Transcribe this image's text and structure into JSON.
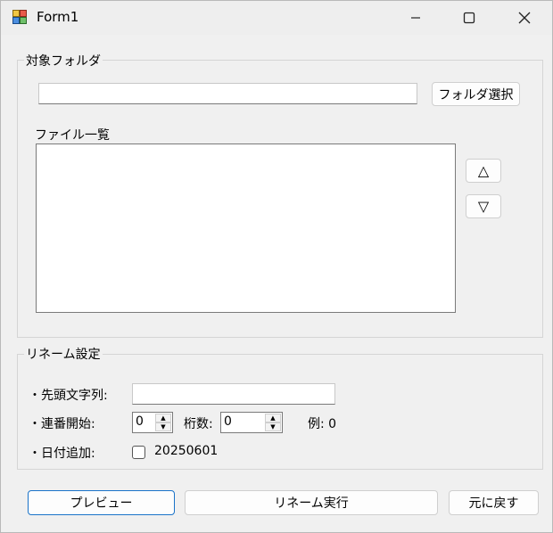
{
  "window": {
    "title": "Form1",
    "minimize_glyph": "—",
    "maximize_glyph": "☐",
    "close_glyph": "✕"
  },
  "folder_group": {
    "label": "対象フォルダ",
    "folder_path_value": "",
    "select_button": "フォルダ選択",
    "file_list_label": "ファイル一覧",
    "move_up_glyph": "△",
    "move_down_glyph": "▽"
  },
  "rename_group": {
    "label": "リネーム設定",
    "prefix_label": "・先頭文字列:",
    "prefix_value": "",
    "seq_start_label": "・連番開始:",
    "seq_start_value": "0",
    "digits_label": "桁数:",
    "digits_value": "0",
    "example_label": "例: 0",
    "date_label": "・日付追加:",
    "date_value": "20250601",
    "date_checked": false
  },
  "buttons": {
    "preview": "プレビュー",
    "rename": "リネーム実行",
    "undo": "元に戻す"
  },
  "colors": {
    "accent_border": "#1a73c9"
  }
}
